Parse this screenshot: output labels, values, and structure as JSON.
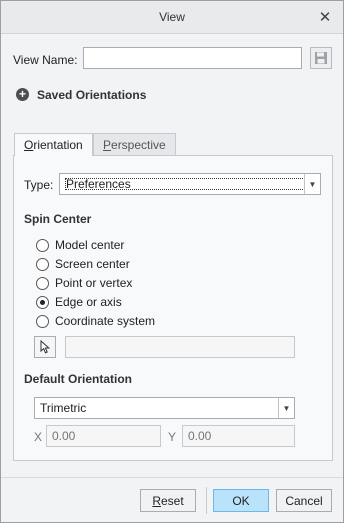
{
  "window": {
    "title": "View"
  },
  "view_name": {
    "label": "View Name:",
    "value": ""
  },
  "saved_orientations": {
    "label": "Saved Orientations"
  },
  "tabs": [
    {
      "label": "Orientation",
      "mnemonic_char": "O",
      "rest": "rientation",
      "active": true
    },
    {
      "label": "Perspective",
      "mnemonic_char": "P",
      "rest": "erspective",
      "active": false
    }
  ],
  "type": {
    "label": "Type:",
    "value": "Preferences"
  },
  "spin_center": {
    "title": "Spin Center",
    "options": [
      {
        "label": "Model center",
        "checked": false
      },
      {
        "label": "Screen center",
        "checked": false
      },
      {
        "label": "Point or vertex",
        "checked": false
      },
      {
        "label": "Edge or axis",
        "checked": true
      },
      {
        "label": "Coordinate system",
        "checked": false
      }
    ],
    "selection_value": ""
  },
  "default_orientation": {
    "title": "Default Orientation",
    "value": "Trimetric",
    "x_label": "X",
    "x_placeholder": "0.00",
    "y_label": "Y",
    "y_placeholder": "0.00"
  },
  "buttons": {
    "reset": {
      "label": "Reset",
      "mnemonic_char": "R",
      "rest": "eset"
    },
    "ok": {
      "label": "OK"
    },
    "cancel": {
      "label": "Cancel"
    }
  },
  "colors": {
    "primary_button": "#b9e3fb",
    "window_bg": "#f2f3f5"
  }
}
